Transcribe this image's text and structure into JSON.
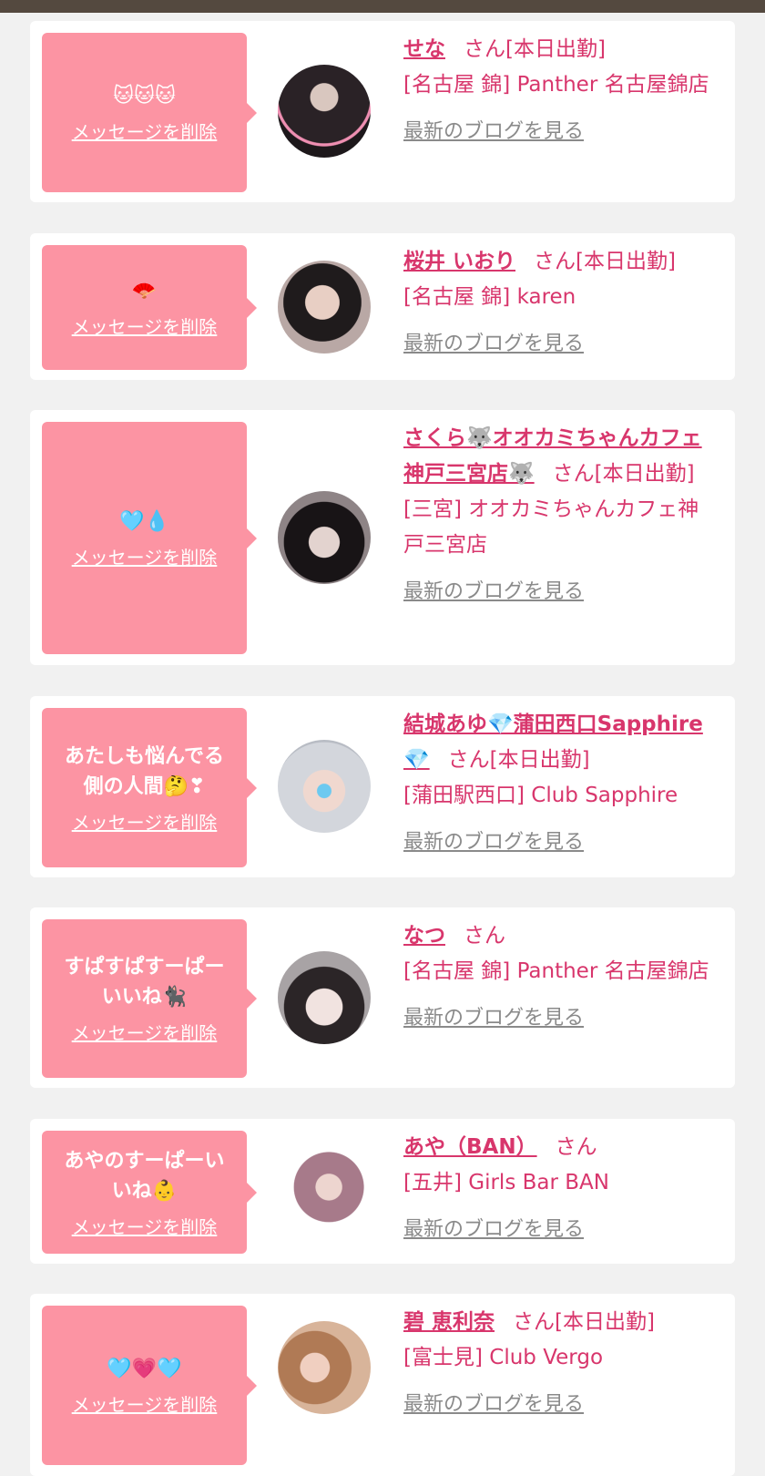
{
  "delete_label": "メッセージを削除",
  "san_label": "さん",
  "blog_label": "最新のブログを見る",
  "cards": [
    {
      "message": "🐱🐱🐱",
      "name": "せな",
      "status": "[本日出勤]",
      "shop": "[名古屋 錦] Panther 名古屋錦店"
    },
    {
      "message": "🪭",
      "name": "桜井 いおり",
      "status": "[本日出勤]",
      "shop": "[名古屋 錦] karen"
    },
    {
      "message": "🩵💧",
      "name": "さくら🐺オオカミちゃんカフェ神戸三宮店🐺",
      "status": "[本日出勤]",
      "shop": "[三宮] オオカミちゃんカフェ神戸三宮店"
    },
    {
      "message": "あたしも悩んでる\n側の人間🤔❣",
      "name": "結城あゆ💎蒲田西口Sapphire💎",
      "status": "[本日出勤]",
      "shop": "[蒲田駅西口] Club Sapphire"
    },
    {
      "message": "すぱすぱすーぱー\nいいね🐈‍⬛",
      "name": "なつ",
      "status": "",
      "shop": "[名古屋 錦] Panther 名古屋錦店"
    },
    {
      "message": "あやのすーぱーい\nいね👶",
      "name": "あや（BAN）",
      "status": "",
      "shop": "[五井] Girls Bar BAN"
    },
    {
      "message": "🩵💗🩵",
      "name": "碧 恵利奈",
      "status": "[本日出勤]",
      "shop": "[富士見] Club Vergo"
    }
  ]
}
